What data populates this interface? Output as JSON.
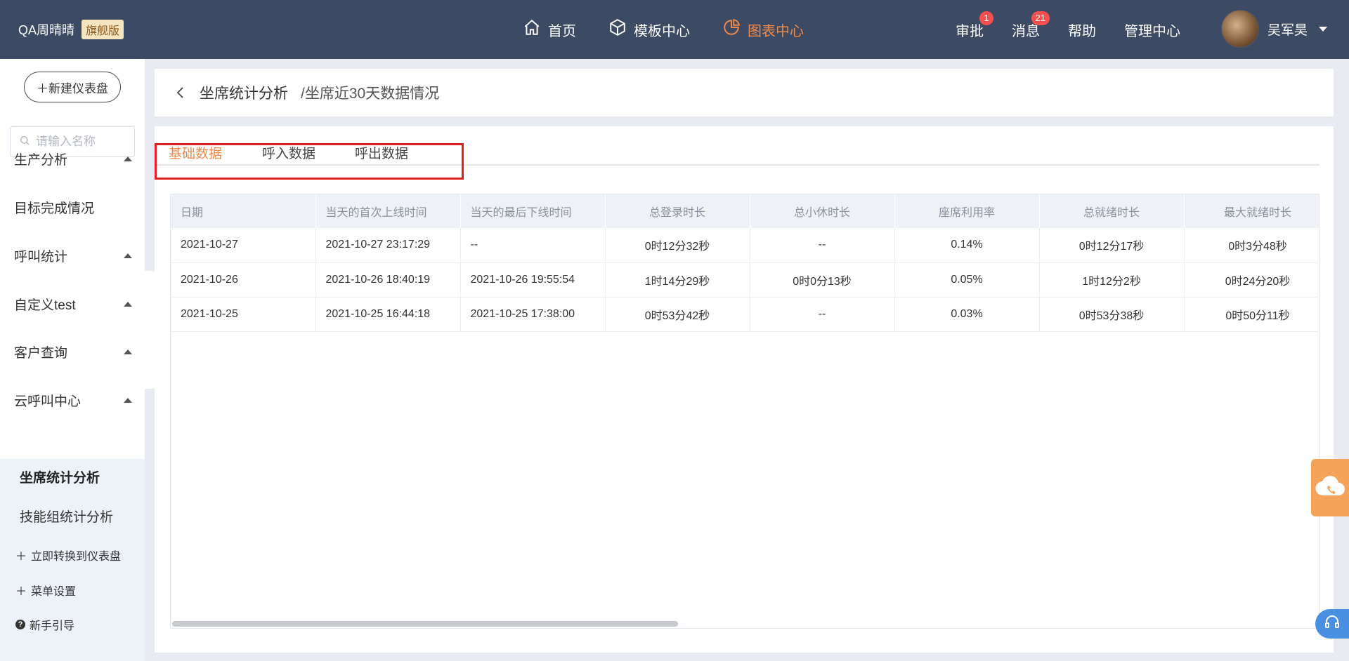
{
  "brand": {
    "name": "QA周晴晴",
    "badge": "旗舰版"
  },
  "nav": [
    {
      "label": "首页",
      "icon": "home-icon"
    },
    {
      "label": "模板中心",
      "icon": "cube-icon"
    },
    {
      "label": "图表中心",
      "icon": "pie-chart-icon",
      "active": true
    }
  ],
  "right_nav": {
    "approve": {
      "label": "审批",
      "badge": "1"
    },
    "messages": {
      "label": "消息",
      "badge": "21"
    },
    "help": {
      "label": "帮助"
    },
    "admin": {
      "label": "管理中心"
    }
  },
  "user": {
    "name": "吴军昊"
  },
  "sidebar": {
    "new_dashboard": "新建仪表盘",
    "search_placeholder": "请输入名称",
    "menu": [
      {
        "label": "生产分析"
      },
      {
        "label": "目标完成情况"
      },
      {
        "label": "呼叫统计"
      },
      {
        "label": "自定义test"
      },
      {
        "label": "客户查询"
      },
      {
        "label": "云呼叫中心"
      }
    ],
    "sub": [
      {
        "label": "坐席统计分析",
        "active": true
      },
      {
        "label": "技能组统计分析"
      }
    ],
    "links": {
      "convert": "立即转换到仪表盘",
      "menu_settings": "菜单设置",
      "guide": "新手引导"
    }
  },
  "header": {
    "title": "坐席统计分析",
    "subtitle": "/坐席近30天数据情况"
  },
  "tabs": [
    {
      "label": "基础数据",
      "active": true
    },
    {
      "label": "呼入数据"
    },
    {
      "label": "呼出数据"
    }
  ],
  "table": {
    "columns": [
      "日期",
      "当天的首次上线时间",
      "当天的最后下线时间",
      "总登录时长",
      "总小休时长",
      "座席利用率",
      "总就绪时长",
      "最大就绪时长"
    ],
    "rows": [
      [
        "2021-10-27",
        "2021-10-27 23:17:29",
        "--",
        "0时12分32秒",
        "--",
        "0.14%",
        "0时12分17秒",
        "0时3分48秒"
      ],
      [
        "2021-10-26",
        "2021-10-26 18:40:19",
        "2021-10-26 19:55:54",
        "1时14分29秒",
        "0时0分13秒",
        "0.05%",
        "1时12分2秒",
        "0时24分20秒"
      ],
      [
        "2021-10-25",
        "2021-10-25 16:44:18",
        "2021-10-25 17:38:00",
        "0时53分42秒",
        "--",
        "0.03%",
        "0时53分38秒",
        "0时50分11秒"
      ]
    ]
  },
  "colors": {
    "topbar": "#3c4a63",
    "accent": "#f08a4b",
    "highlight_border": "#e02020",
    "badge": "#f5504d"
  }
}
